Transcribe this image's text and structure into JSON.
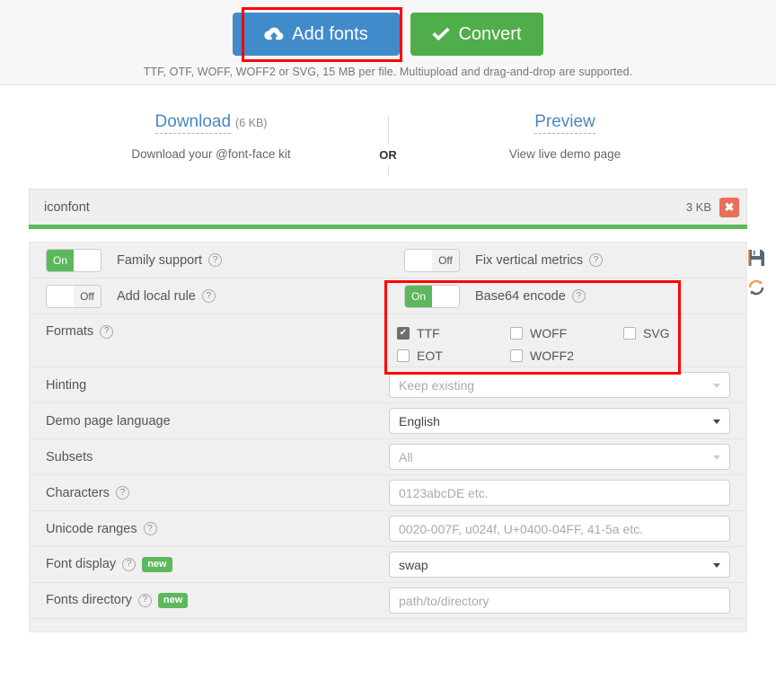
{
  "toolbar": {
    "add_fonts_label": "Add fonts",
    "convert_label": "Convert",
    "hint": "TTF, OTF, WOFF, WOFF2 or SVG, 15 MB per file. Multiupload and drag-and-drop are supported.",
    "add_fonts_color": "#428bca",
    "convert_color": "#4fad4a",
    "highlight_color": "#ff0000"
  },
  "actions": {
    "download_label": "Download",
    "download_size": "(6 KB)",
    "download_sub": "Download your @font-face kit",
    "separator": "OR",
    "preview_label": "Preview",
    "preview_sub": "View live demo page",
    "link_color": "#4a87c4"
  },
  "file": {
    "name": "iconfont",
    "size": "3 KB",
    "delete_label": "✖",
    "progress_color": "#5cb85c",
    "progress_percent": 100
  },
  "settings": {
    "family_support": {
      "label": "Family support",
      "state": "On",
      "on_label": "On",
      "off_label": "Off"
    },
    "fix_vertical_metrics": {
      "label": "Fix vertical metrics",
      "state": "Off",
      "on_label": "On",
      "off_label": "Off"
    },
    "add_local_rule": {
      "label": "Add local rule",
      "state": "Off",
      "on_label": "On",
      "off_label": "Off"
    },
    "base64_encode": {
      "label": "Base64 encode",
      "state": "On",
      "on_label": "On",
      "off_label": "Off"
    },
    "formats": {
      "label": "Formats",
      "items": [
        {
          "label": "TTF",
          "checked": true
        },
        {
          "label": "WOFF",
          "checked": false
        },
        {
          "label": "SVG",
          "checked": false
        },
        {
          "label": "EOT",
          "checked": false
        },
        {
          "label": "WOFF2",
          "checked": false
        }
      ]
    },
    "fields": [
      {
        "label": "Hinting",
        "type": "select",
        "value": "Keep existing",
        "filled": false,
        "help": false,
        "new": false
      },
      {
        "label": "Demo page language",
        "type": "select",
        "value": "English",
        "filled": true,
        "help": false,
        "new": false
      },
      {
        "label": "Subsets",
        "type": "select",
        "value": "All",
        "filled": false,
        "help": false,
        "new": false
      },
      {
        "label": "Characters",
        "type": "input",
        "value": "",
        "placeholder": "0123abcDE etc.",
        "help": true,
        "new": false
      },
      {
        "label": "Unicode ranges",
        "type": "input",
        "value": "",
        "placeholder": "0020-007F, u024f, U+0400-04FF, 41-5a etc.",
        "help": true,
        "new": false
      },
      {
        "label": "Font display",
        "type": "select",
        "value": "swap",
        "filled": true,
        "help": true,
        "new": true
      },
      {
        "label": "Fonts directory",
        "type": "input",
        "value": "",
        "placeholder": "path/to/directory",
        "help": true,
        "new": true
      }
    ],
    "help_glyph": "?",
    "new_badge": "new",
    "side_icons": [
      "save-icon",
      "reset-icon"
    ]
  }
}
